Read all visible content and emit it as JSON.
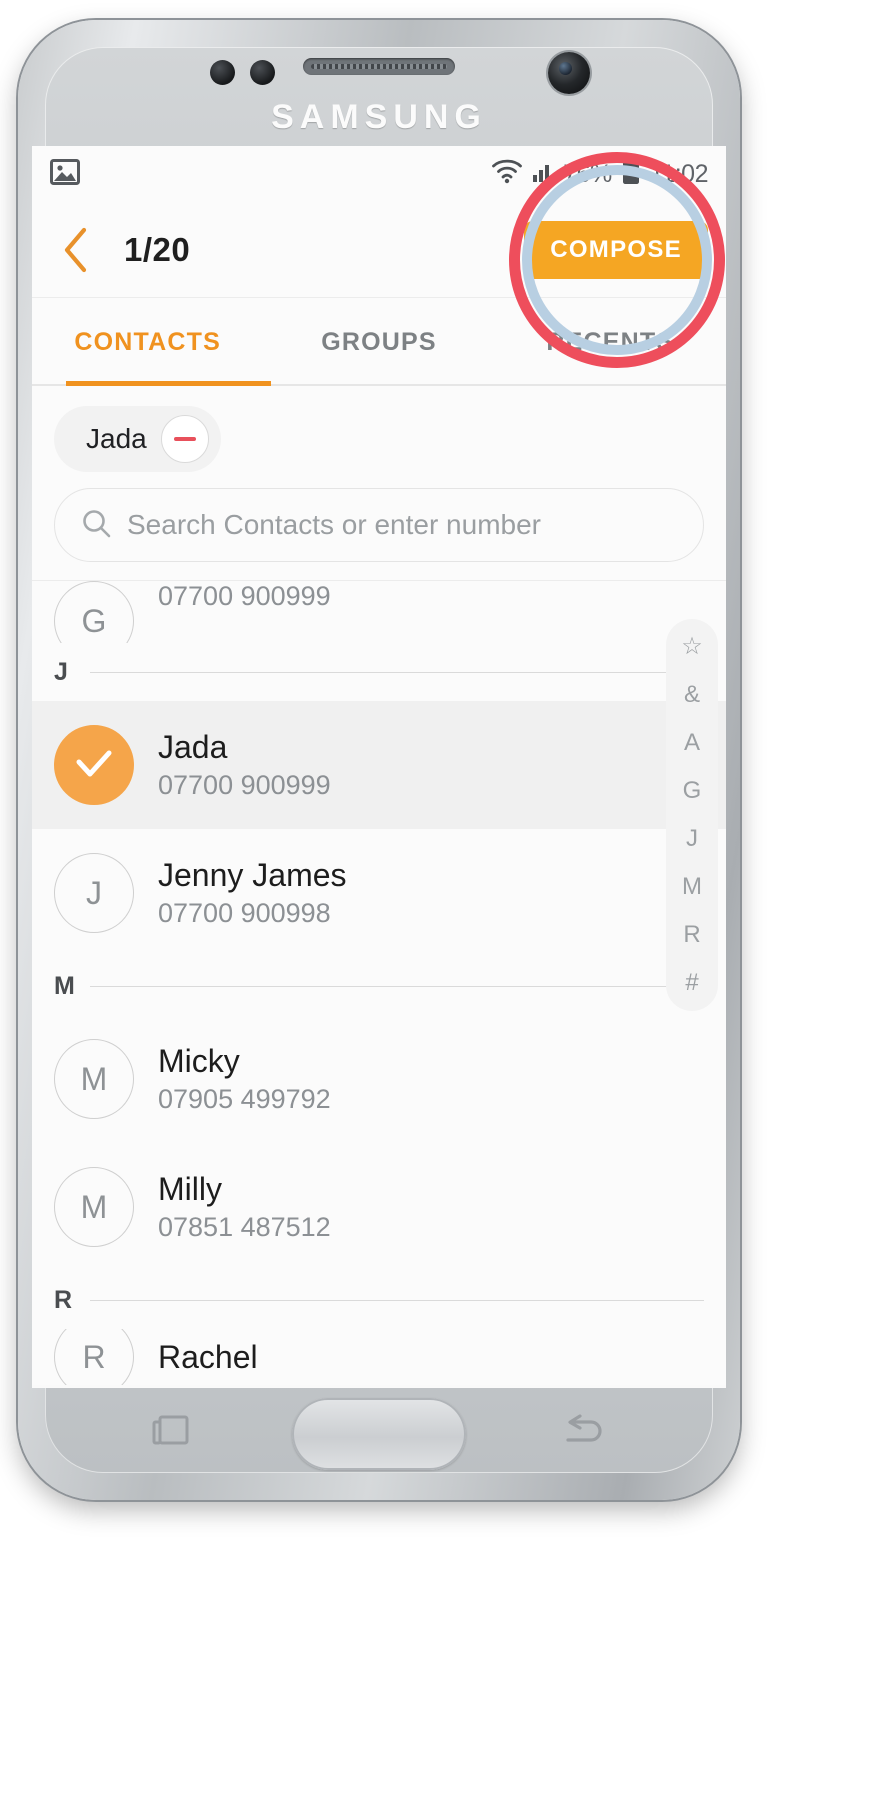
{
  "device": {
    "brand": "SAMSUNG",
    "recents_key": "recents-key",
    "back_key": "back-key"
  },
  "status_bar": {
    "left_icon": "image-icon",
    "wifi_icon": "wifi-icon",
    "signal_icon": "signal-icon",
    "battery_percent": "76%",
    "battery_icon": "battery-icon",
    "clock": "11:02"
  },
  "header": {
    "back_icon": "back-chevron-icon",
    "counter": "1/20",
    "compose_label": "COMPOSE"
  },
  "tabs": [
    {
      "label": "CONTACTS",
      "active": true
    },
    {
      "label": "GROUPS",
      "active": false
    },
    {
      "label": "RECENTS",
      "active": false
    }
  ],
  "chips": [
    {
      "label": "Jada",
      "remove_icon": "minus-icon"
    }
  ],
  "search": {
    "icon": "search-icon",
    "placeholder": "Search Contacts or enter number"
  },
  "list": {
    "partial_top": {
      "number": "07700 900999",
      "avatar_initial": "G"
    },
    "sections": [
      {
        "letter": "J",
        "rows": [
          {
            "name": "Jada",
            "number": "07700 900999",
            "initial": "J",
            "selected": true
          },
          {
            "name": "Jenny James",
            "number": "07700 900998",
            "initial": "J",
            "selected": false
          }
        ]
      },
      {
        "letter": "M",
        "rows": [
          {
            "name": "Micky",
            "number": "07905 499792",
            "initial": "M",
            "selected": false
          },
          {
            "name": "Milly",
            "number": "07851 487512",
            "initial": "M",
            "selected": false
          }
        ]
      },
      {
        "letter": "R",
        "rows": [
          {
            "name": "Rachel",
            "number": "",
            "initial": "R",
            "selected": false
          }
        ]
      }
    ]
  },
  "alpha_index": [
    "☆",
    "&",
    "A",
    "G",
    "J",
    "M",
    "R",
    "#"
  ],
  "colors": {
    "accent_orange": "#f0921f",
    "compose_bg": "#f5a623",
    "highlight_red": "#ee4e5c",
    "highlight_blue": "#b8cfe2",
    "chip_minus": "#e8505b"
  }
}
